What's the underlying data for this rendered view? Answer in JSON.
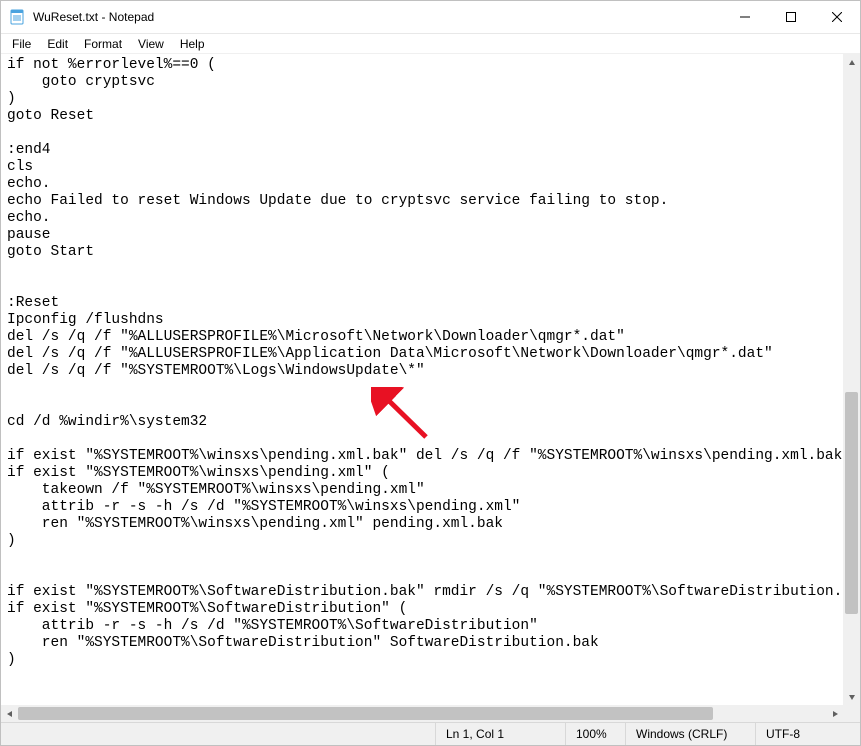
{
  "window": {
    "title": "WuReset.txt - Notepad"
  },
  "menu": {
    "file": "File",
    "edit": "Edit",
    "format": "Format",
    "view": "View",
    "help": "Help"
  },
  "editor": {
    "content": "if not %errorlevel%==0 (\n    goto cryptsvc\n)\ngoto Reset\n\n:end4\ncls\necho.\necho Failed to reset Windows Update due to cryptsvc service failing to stop.\necho.\npause\ngoto Start\n\n\n:Reset\nIpconfig /flushdns\ndel /s /q /f \"%ALLUSERSPROFILE%\\Microsoft\\Network\\Downloader\\qmgr*.dat\"\ndel /s /q /f \"%ALLUSERSPROFILE%\\Application Data\\Microsoft\\Network\\Downloader\\qmgr*.dat\"\ndel /s /q /f \"%SYSTEMROOT%\\Logs\\WindowsUpdate\\*\"\n\n\ncd /d %windir%\\system32\n\nif exist \"%SYSTEMROOT%\\winsxs\\pending.xml.bak\" del /s /q /f \"%SYSTEMROOT%\\winsxs\\pending.xml.bak\"\nif exist \"%SYSTEMROOT%\\winsxs\\pending.xml\" (\n    takeown /f \"%SYSTEMROOT%\\winsxs\\pending.xml\"\n    attrib -r -s -h /s /d \"%SYSTEMROOT%\\winsxs\\pending.xml\"\n    ren \"%SYSTEMROOT%\\winsxs\\pending.xml\" pending.xml.bak\n)\n\n\nif exist \"%SYSTEMROOT%\\SoftwareDistribution.bak\" rmdir /s /q \"%SYSTEMROOT%\\SoftwareDistribution.bak\"\nif exist \"%SYSTEMROOT%\\SoftwareDistribution\" (\n    attrib -r -s -h /s /d \"%SYSTEMROOT%\\SoftwareDistribution\"\n    ren \"%SYSTEMROOT%\\SoftwareDistribution\" SoftwareDistribution.bak\n)\n"
  },
  "status": {
    "position": "Ln 1, Col 1",
    "zoom": "100%",
    "eol": "Windows (CRLF)",
    "encoding": "UTF-8"
  },
  "annotation": {
    "arrow_color": "#E81123"
  }
}
